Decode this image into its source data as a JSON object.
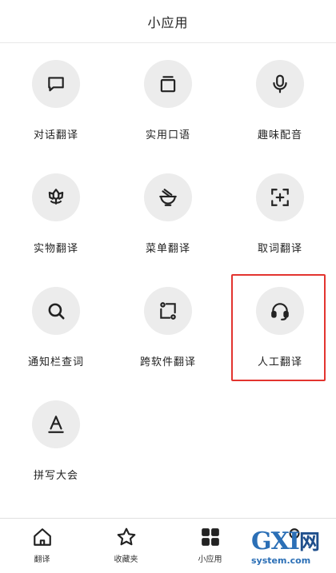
{
  "header": {
    "title": "小应用"
  },
  "apps": [
    {
      "label": "对话翻译",
      "icon": "chat-bubble-icon"
    },
    {
      "label": "实用口语",
      "icon": "card-stack-icon"
    },
    {
      "label": "趣味配音",
      "icon": "microphone-icon"
    },
    {
      "label": "实物翻译",
      "icon": "flower-icon"
    },
    {
      "label": "菜单翻译",
      "icon": "noodle-bowl-icon"
    },
    {
      "label": "取词翻译",
      "icon": "scan-add-icon"
    },
    {
      "label": "通知栏查词",
      "icon": "magnifier-icon"
    },
    {
      "label": "跨软件翻译",
      "icon": "app-switch-icon"
    },
    {
      "label": "人工翻译",
      "icon": "headset-icon"
    },
    {
      "label": "拼写大会",
      "icon": "letter-a-icon"
    }
  ],
  "highlight": {
    "target": "人工翻译",
    "color": "#e3342f"
  },
  "tabbar": {
    "items": [
      {
        "label": "翻译",
        "icon": "home-icon"
      },
      {
        "label": "收藏夹",
        "icon": "star-icon"
      },
      {
        "label": "小应用",
        "icon": "grid-apps-icon",
        "active": true
      },
      {
        "label": "",
        "icon": "profile-icon"
      }
    ]
  },
  "watermark": {
    "main": "GXI",
    "net": "网",
    "sub": "system.com"
  }
}
